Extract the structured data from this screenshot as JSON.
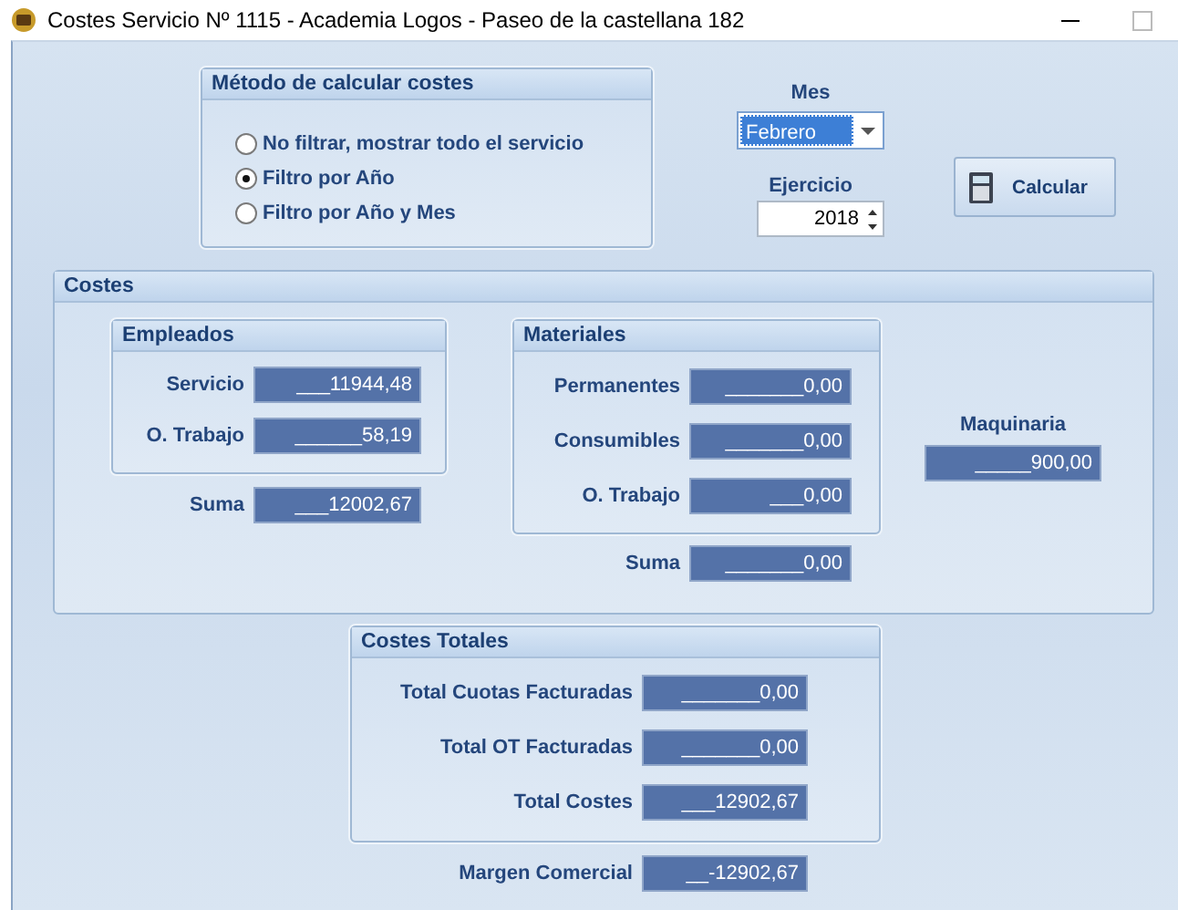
{
  "window": {
    "title": "Costes Servicio Nº 1115 - Academia Logos - Paseo de la castellana 182"
  },
  "method_group": {
    "title": "Método de calcular costes",
    "options": [
      {
        "label": "No filtrar, mostrar todo el servicio",
        "selected": false
      },
      {
        "label": "Filtro por Año",
        "selected": true
      },
      {
        "label": "Filtro por Año y Mes",
        "selected": false
      }
    ]
  },
  "month": {
    "label": "Mes",
    "value": "Febrero"
  },
  "year": {
    "label": "Ejercicio",
    "value": "2018"
  },
  "calculate_button": {
    "label": "Calcular"
  },
  "costs": {
    "title": "Costes",
    "employees": {
      "title": "Empleados",
      "fields": [
        {
          "label": "Servicio",
          "value": "___11944,48"
        },
        {
          "label": "O. Trabajo",
          "value": "______58,19"
        }
      ]
    },
    "employees_sum": {
      "label": "Suma",
      "value": "___12002,67"
    },
    "materials": {
      "title": "Materiales",
      "fields": [
        {
          "label": "Permanentes",
          "value": "_______0,00"
        },
        {
          "label": "Consumibles",
          "value": "_______0,00"
        },
        {
          "label": "O. Trabajo",
          "value": "___0,00"
        }
      ]
    },
    "materials_sum": {
      "label": "Suma",
      "value": "_______0,00"
    },
    "machinery": {
      "label": "Maquinaria",
      "value": "_____900,00"
    }
  },
  "totals": {
    "title": "Costes Totales",
    "fields": [
      {
        "label": "Total Cuotas Facturadas",
        "value": "_______0,00"
      },
      {
        "label": "Total OT Facturadas",
        "value": "_______0,00"
      },
      {
        "label": "Total Costes",
        "value": "___12902,67"
      }
    ]
  },
  "margin": {
    "label": "Margen Comercial",
    "value": "__-12902,67"
  }
}
